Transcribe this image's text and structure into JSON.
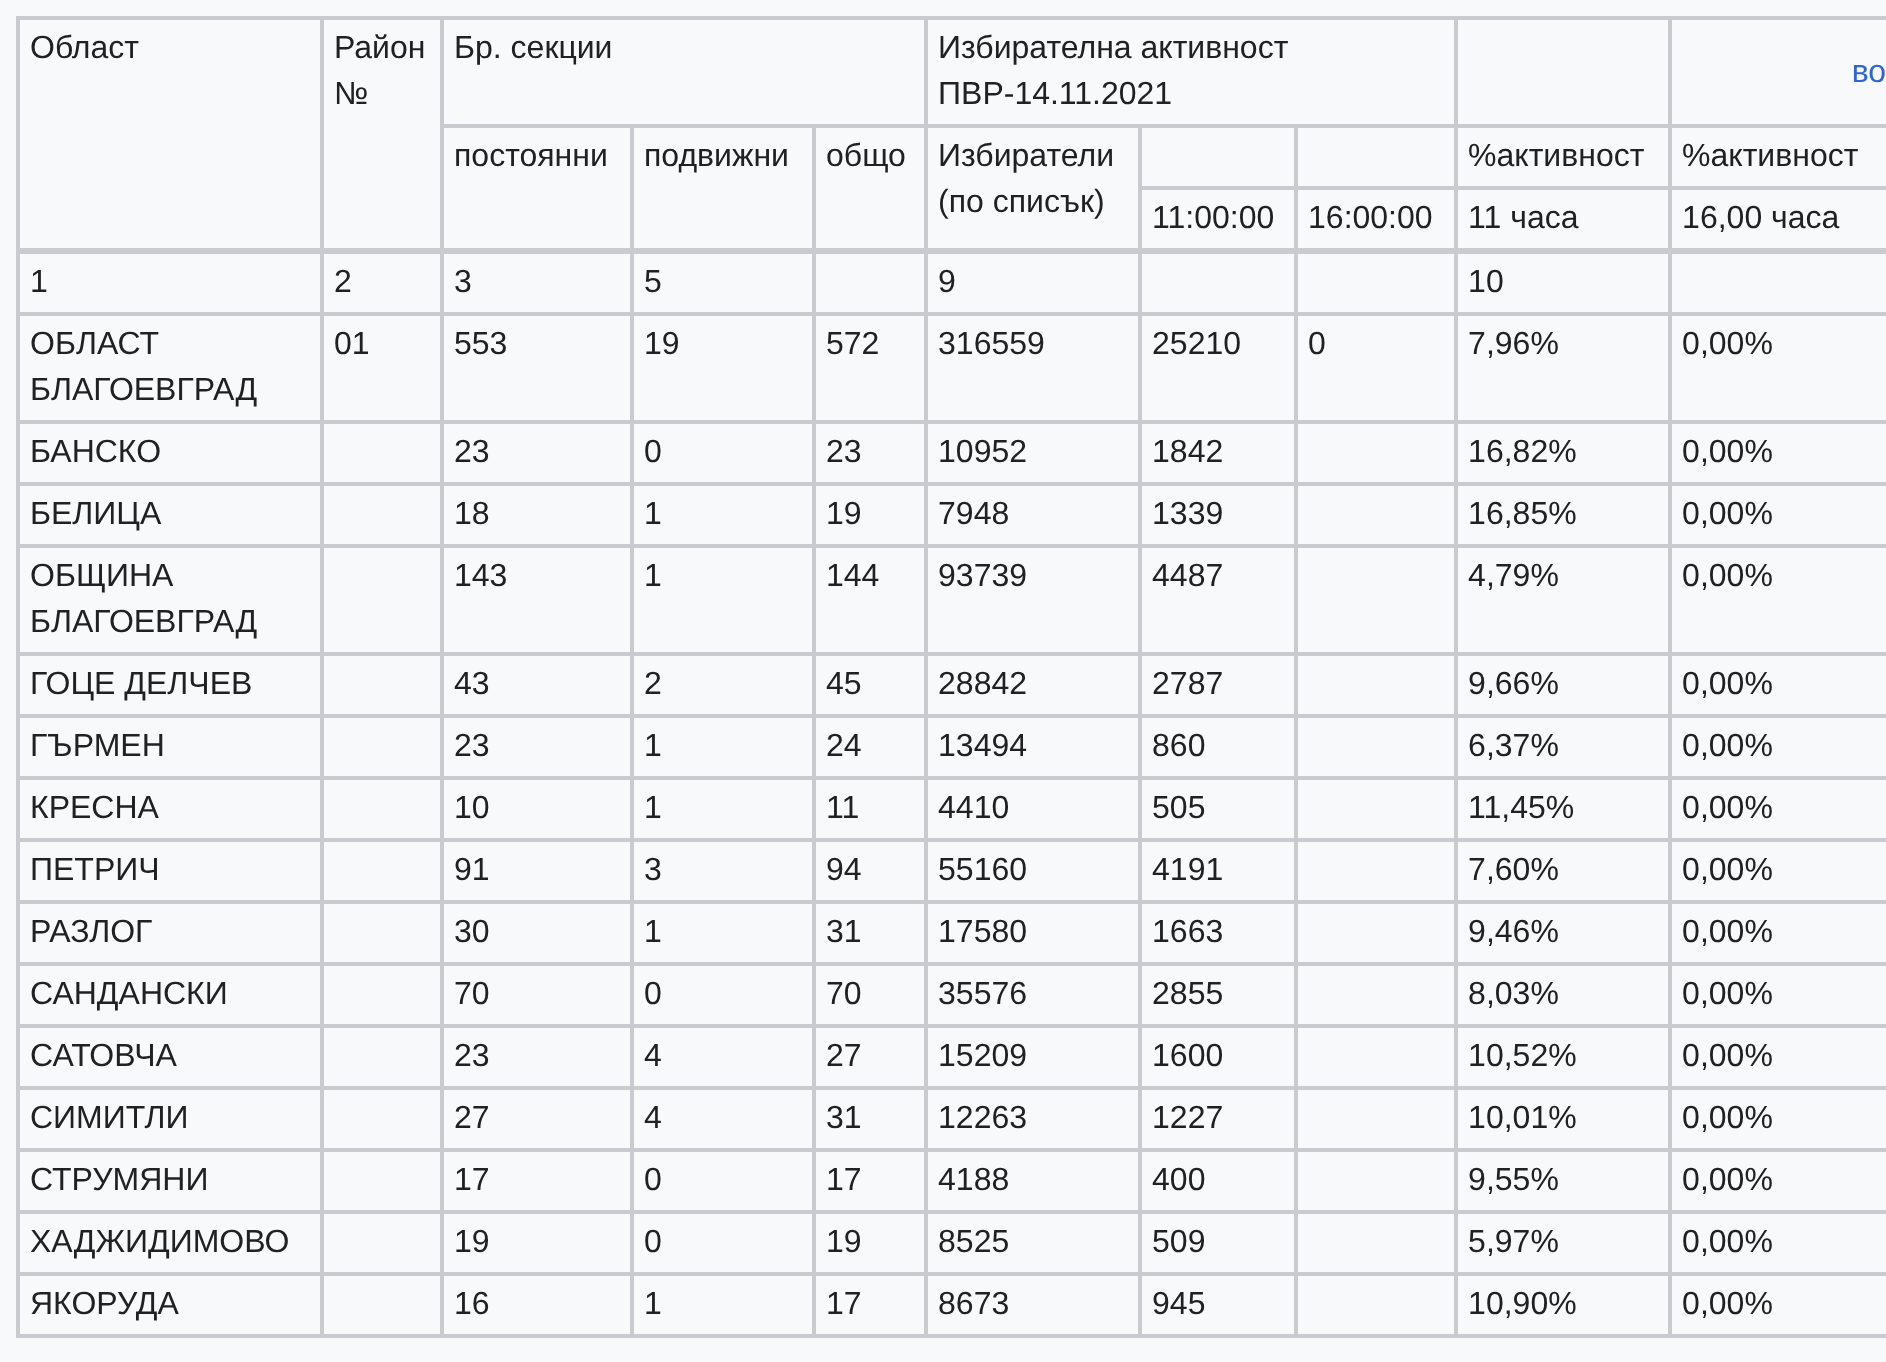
{
  "header": {
    "region": "Област",
    "district_no": "Район №",
    "sections": "Бр. секции",
    "turnout": "Избирателна активност ПВР-14.11.2021",
    "link": "во",
    "permanent": "постоянни",
    "mobile": "подвижни",
    "total": "общо",
    "voters": "Избиратели (по списък)",
    "time_1": "11:00:00",
    "time_2": "16:00:00",
    "activity_1": "%активност",
    "hours_1": "11 часа",
    "activity_2": "%активност",
    "hours_2": "16,00 часа"
  },
  "column_numbers": {
    "name": "1",
    "district": "2",
    "permanent": "3",
    "mobile": "5",
    "voters": "9",
    "pct_11": "10"
  },
  "rows": [
    {
      "name": "ОБЛАСТ БЛАГОЕВГРАД",
      "district": "01",
      "permanent": "553",
      "mobile": "19",
      "total": "572",
      "voters": "316559",
      "at_11": "25210",
      "at_16": "0",
      "pct_11": "7,96%",
      "pct_16": "0,00%"
    },
    {
      "name": "БАНСКО",
      "permanent": "23",
      "mobile": "0",
      "total": "23",
      "voters": "10952",
      "at_11": "1842",
      "pct_11": "16,82%",
      "pct_16": "0,00%"
    },
    {
      "name": "БЕЛИЦА",
      "permanent": "18",
      "mobile": "1",
      "total": "19",
      "voters": "7948",
      "at_11": "1339",
      "pct_11": "16,85%",
      "pct_16": "0,00%"
    },
    {
      "name": "ОБЩИНА БЛАГОЕВГРАД",
      "permanent": "143",
      "mobile": "1",
      "total": "144",
      "voters": "93739",
      "at_11": "4487",
      "pct_11": "4,79%",
      "pct_16": "0,00%"
    },
    {
      "name": "ГОЦЕ ДЕЛЧЕВ",
      "permanent": "43",
      "mobile": "2",
      "total": "45",
      "voters": "28842",
      "at_11": "2787",
      "pct_11": "9,66%",
      "pct_16": "0,00%"
    },
    {
      "name": "ГЪРМЕН",
      "permanent": "23",
      "mobile": "1",
      "total": "24",
      "voters": "13494",
      "at_11": "860",
      "pct_11": "6,37%",
      "pct_16": "0,00%"
    },
    {
      "name": "КРЕСНА",
      "permanent": "10",
      "mobile": "1",
      "total": "11",
      "voters": "4410",
      "at_11": "505",
      "pct_11": "11,45%",
      "pct_16": "0,00%"
    },
    {
      "name": "ПЕТРИЧ",
      "permanent": "91",
      "mobile": "3",
      "total": "94",
      "voters": "55160",
      "at_11": "4191",
      "pct_11": "7,60%",
      "pct_16": "0,00%"
    },
    {
      "name": "РАЗЛОГ",
      "permanent": "30",
      "mobile": "1",
      "total": "31",
      "voters": "17580",
      "at_11": "1663",
      "pct_11": "9,46%",
      "pct_16": "0,00%"
    },
    {
      "name": "САНДАНСКИ",
      "permanent": "70",
      "mobile": "0",
      "total": "70",
      "voters": "35576",
      "at_11": "2855",
      "pct_11": "8,03%",
      "pct_16": "0,00%"
    },
    {
      "name": "САТОВЧА",
      "permanent": "23",
      "mobile": "4",
      "total": "27",
      "voters": "15209",
      "at_11": "1600",
      "pct_11": "10,52%",
      "pct_16": "0,00%"
    },
    {
      "name": "СИМИТЛИ",
      "permanent": "27",
      "mobile": "4",
      "total": "31",
      "voters": "12263",
      "at_11": "1227",
      "pct_11": "10,01%",
      "pct_16": "0,00%"
    },
    {
      "name": "СТРУМЯНИ",
      "permanent": "17",
      "mobile": "0",
      "total": "17",
      "voters": "4188",
      "at_11": "400",
      "pct_11": "9,55%",
      "pct_16": "0,00%"
    },
    {
      "name": "ХАДЖИДИМОВО",
      "permanent": "19",
      "mobile": "0",
      "total": "19",
      "voters": "8525",
      "at_11": "509",
      "pct_11": "5,97%",
      "pct_16": "0,00%"
    },
    {
      "name": "ЯКОРУДА",
      "permanent": "16",
      "mobile": "1",
      "total": "17",
      "voters": "8673",
      "at_11": "945",
      "pct_11": "10,90%",
      "pct_16": "0,00%"
    }
  ]
}
